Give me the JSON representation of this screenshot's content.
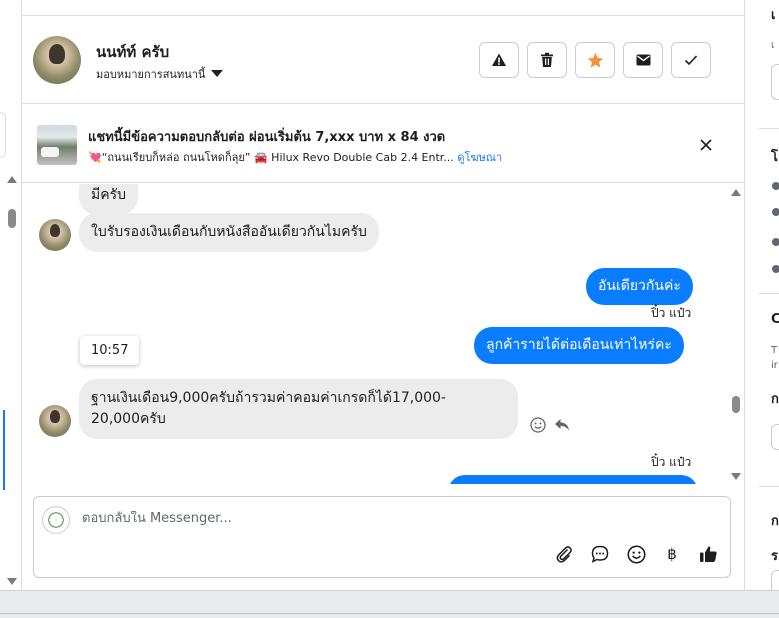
{
  "contact": {
    "name": "นนท์ท์ ครับ",
    "assign_label": "มอบหมายการสนทนานี้"
  },
  "header_actions": [
    {
      "name": "report-button",
      "icon": "warning-icon"
    },
    {
      "name": "delete-button",
      "icon": "trash-icon"
    },
    {
      "name": "star-button",
      "icon": "star-icon"
    },
    {
      "name": "mark-unread-button",
      "icon": "envelope-icon"
    },
    {
      "name": "mark-done-button",
      "icon": "check-icon"
    }
  ],
  "ad": {
    "title": "แชทนี้มีข้อความตอบกลับต่อ ผ่อนเริ่มต้น 7,xxx บาท x 84 งวด",
    "subtitle": "💘“ถนนเรียบก็หล่อ ถนนโหดก็ลุย” 🚘 Hilux Revo Double Cab 2.4 Entr...",
    "link": "ดูโฆษณา"
  },
  "messages": {
    "in_1": "มีครับ",
    "in_2": "ใบรับรองเงินเดือนกับหนังสืออันเดียวกันไมครับ",
    "out_1": "อันเดียวกันค่ะ",
    "seen_1": "ปิ๋ว แป๋ว",
    "out_2": "ลูกค้ารายได้ต่อเดือนเท่าไหร่คะ",
    "time": "10:57",
    "in_3": "ฐานเงินเดือน9,000ครับถ้ารวมค่าคอมค่าเกรดก็ได้17,000-20,000ครับ",
    "seen_2": "ปิ๋ว แป๋ว"
  },
  "composer": {
    "placeholder": "ตอบกลับใน Messenger...",
    "value": "",
    "icons": [
      "paperclip-icon",
      "chat-bubble-icon",
      "emoji-icon",
      "baht-icon",
      "thumbs-up-icon"
    ],
    "baht_symbol": "฿"
  },
  "right_panel": {
    "t1": "เ",
    "s1": "เ",
    "t2": "โ",
    "t3": "C",
    "s3a": "T",
    "s3b": "ir",
    "t4": "ก",
    "t5": "ก",
    "t6": "ร"
  },
  "colors": {
    "accent": "#1877f2",
    "outgoing_bubble": "#0a7cff",
    "incoming_bubble": "#ececec",
    "star": "#f0923a"
  }
}
